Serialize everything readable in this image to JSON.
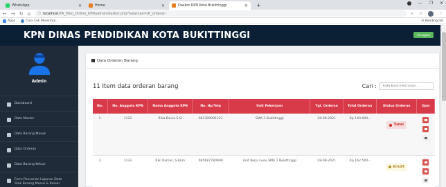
{
  "browser": {
    "tabs": [
      {
        "label": "WhatsApp",
        "color": "#25d366"
      },
      {
        "label": "Home",
        "color": "#e67e22"
      },
      {
        "label": "Daskor KPN Kota Bukittinggi",
        "color": "#e67e22"
      }
    ],
    "new_tab": "+",
    "url_host": "localhost",
    "url_path": "/TA_Toko_Online_KPN/admin/daskor.php?halaman=dt_orderan",
    "bookmarks": [
      {
        "label": "Apps"
      },
      {
        "label": "Cara Cek Penerima..."
      }
    ],
    "reading_list": "Reading list"
  },
  "header": {
    "title": "KPN DINAS PENDIDIKAN KOTA BUKITTINGGI",
    "logout_label": "Logout"
  },
  "sidebar": {
    "user_label": "Admin",
    "items": [
      {
        "label": "Dashboard"
      },
      {
        "label": "Data Master"
      },
      {
        "label": "Data Barang Masuk"
      },
      {
        "label": "Data Orderan"
      },
      {
        "label": "Data Barang Keluar"
      },
      {
        "label": "Form Pencarian Laporan Data Stok Barang Masuk & Keluar"
      }
    ]
  },
  "main": {
    "panel_title": "Data Orderan Barang",
    "item_count": "11 Item data orderan barang",
    "search_label": "Cari :",
    "search_placeholder": "Kata Kunci Pencarian...",
    "table": {
      "headers": [
        "No.",
        "No. Anggota KPN",
        "Nama Anggota KPN",
        "No. Hp/Telp",
        "Unit Pekerjaan",
        "Tgl. Orderan",
        "Total Orderan",
        "Status Orderan",
        "Opsi"
      ],
      "rows": [
        {
          "no": "1.",
          "anggota": "1122",
          "nama": "Rika Devia S.Si",
          "hp": "081390091221",
          "unit": "SMA 2 Bukittinggi",
          "tgl": "28-08-2021",
          "total": "Rp 140.000,-",
          "status": "Tunai",
          "status_type": "tunai"
        },
        {
          "no": "2.",
          "anggota": "1133",
          "nama": "Riki Ramlis, S.Kom",
          "hp": "085687780990",
          "unit": "Unit Kerja Guru SMA 1 Bukittinggi",
          "tgl": "28-08-2021",
          "total": "Rp 162.500,-",
          "status": "Kredit",
          "status_type": "kredit"
        }
      ]
    }
  }
}
